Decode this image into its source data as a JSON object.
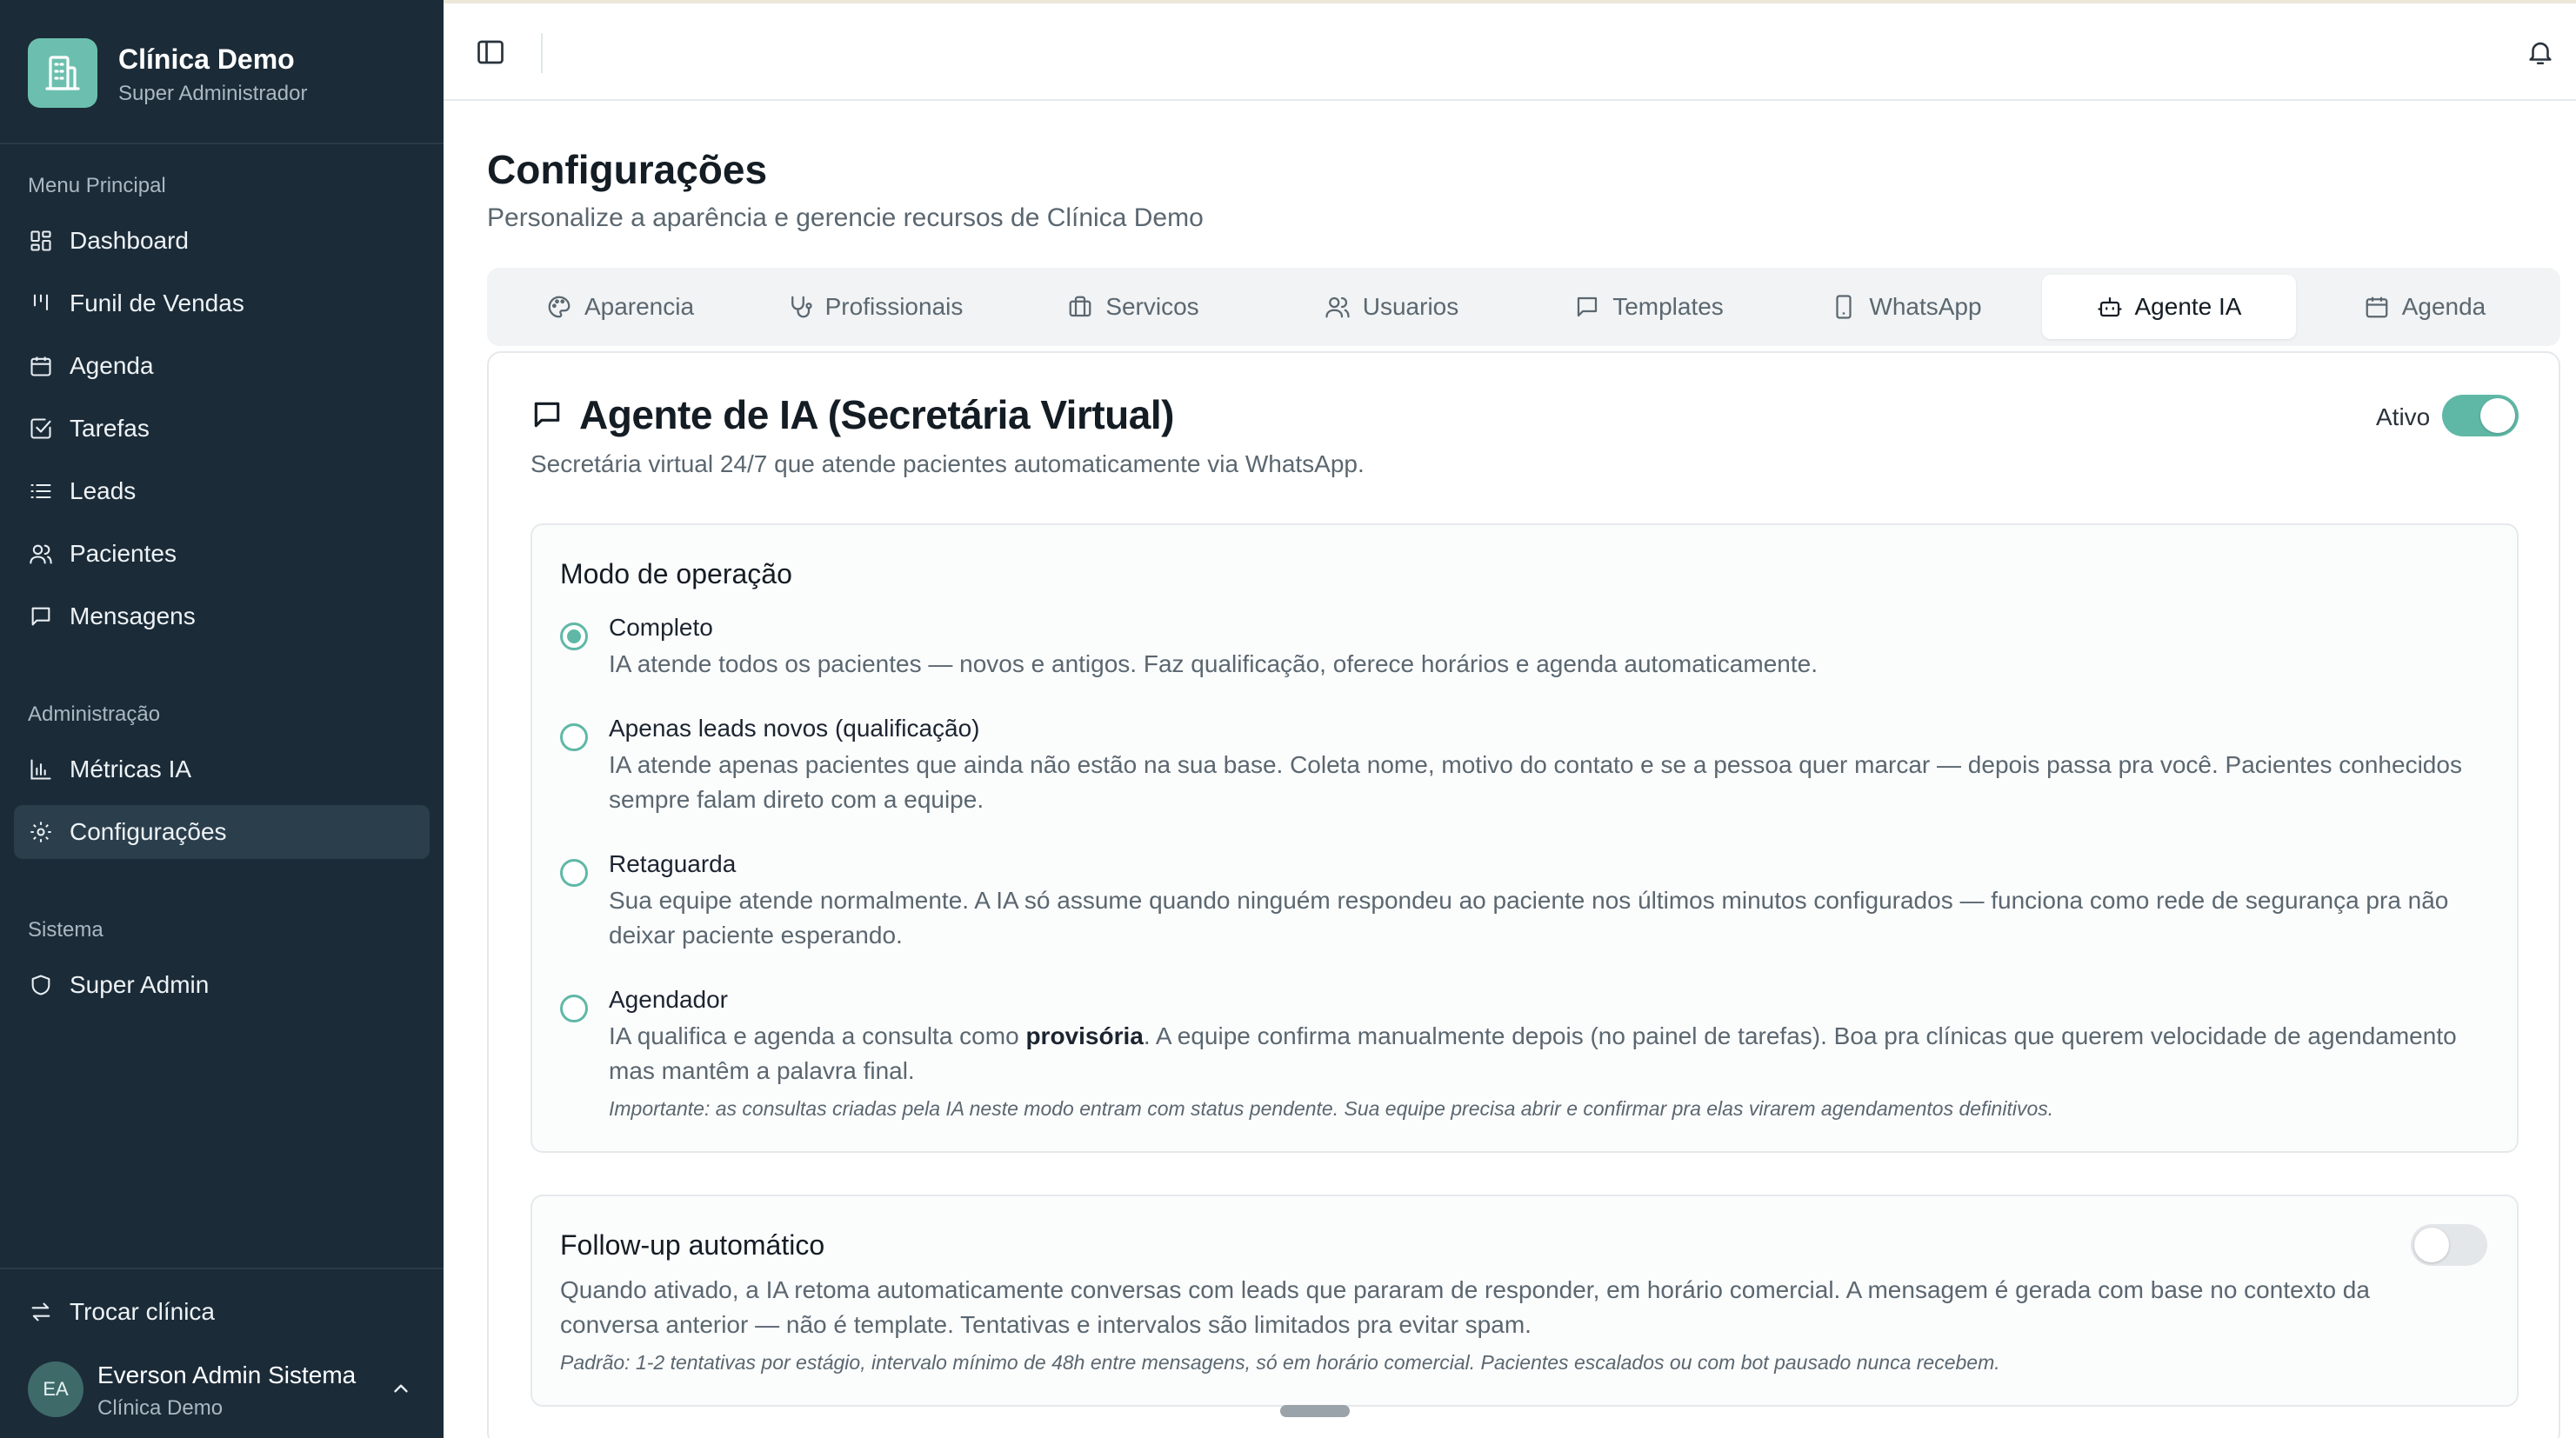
{
  "brand": {
    "title": "Clínica Demo",
    "subtitle": "Super Administrador"
  },
  "sidebar": {
    "sections": [
      {
        "label": "Menu Principal",
        "items": [
          {
            "label": "Dashboard",
            "icon": "dashboard-icon"
          },
          {
            "label": "Funil de Vendas",
            "icon": "funnel-icon"
          },
          {
            "label": "Agenda",
            "icon": "calendar-icon"
          },
          {
            "label": "Tarefas",
            "icon": "checkbox-icon"
          },
          {
            "label": "Leads",
            "icon": "list-icon"
          },
          {
            "label": "Pacientes",
            "icon": "users-icon"
          },
          {
            "label": "Mensagens",
            "icon": "message-icon"
          }
        ]
      },
      {
        "label": "Administração",
        "items": [
          {
            "label": "Métricas IA",
            "icon": "bar-chart-icon"
          },
          {
            "label": "Configurações",
            "icon": "gear-icon",
            "active": true
          }
        ]
      },
      {
        "label": "Sistema",
        "items": [
          {
            "label": "Super Admin",
            "icon": "shield-icon"
          }
        ]
      }
    ],
    "footer": {
      "switch_label": "Trocar clínica",
      "user_initials": "EA",
      "user_name": "Everson Admin Sistema",
      "user_clinic": "Clínica Demo"
    }
  },
  "page": {
    "title": "Configurações",
    "subtitle": "Personalize a aparência e gerencie recursos de Clínica Demo"
  },
  "tabs": [
    {
      "label": "Aparencia",
      "icon": "palette-icon"
    },
    {
      "label": "Profissionais",
      "icon": "stethoscope-icon"
    },
    {
      "label": "Servicos",
      "icon": "briefcase-icon"
    },
    {
      "label": "Usuarios",
      "icon": "users-icon"
    },
    {
      "label": "Templates",
      "icon": "message-icon"
    },
    {
      "label": "WhatsApp",
      "icon": "phone-icon"
    },
    {
      "label": "Agente IA",
      "icon": "bot-icon",
      "active": true
    },
    {
      "label": "Agenda",
      "icon": "calendar-icon"
    }
  ],
  "agent": {
    "title": "Agente de IA (Secretária Virtual)",
    "description": "Secretária virtual 24/7 que atende pacientes automaticamente via WhatsApp.",
    "active_label": "Ativo",
    "active": true
  },
  "mode": {
    "heading": "Modo de operação",
    "options": [
      {
        "title": "Completo",
        "description": "IA atende todos os pacientes — novos e antigos. Faz qualificação, oferece horários e agenda automaticamente.",
        "checked": true
      },
      {
        "title": "Apenas leads novos (qualificação)",
        "description": "IA atende apenas pacientes que ainda não estão na sua base. Coleta nome, motivo do contato e se a pessoa quer marcar — depois passa pra você. Pacientes conhecidos sempre falam direto com a equipe.",
        "checked": false
      },
      {
        "title": "Retaguarda",
        "description": "Sua equipe atende normalmente. A IA só assume quando ninguém respondeu ao paciente nos últimos minutos configurados — funciona como rede de segurança pra não deixar paciente esperando.",
        "checked": false
      },
      {
        "title": "Agendador",
        "description_before": "IA qualifica e agenda a consulta como ",
        "description_bold": "provisória",
        "description_after": ". A equipe confirma manualmente depois (no painel de tarefas). Boa pra clínicas que querem velocidade de agendamento mas mantêm a palavra final.",
        "note": "Importante: as consultas criadas pela IA neste modo entram com status pendente. Sua equipe precisa abrir e confirmar pra elas virarem agendamentos definitivos.",
        "checked": false
      }
    ]
  },
  "followup": {
    "heading": "Follow-up automático",
    "description": "Quando ativado, a IA retoma automaticamente conversas com leads que pararam de responder, em horário comercial. A mensagem é gerada com base no contexto da conversa anterior — não é template. Tentativas e intervalos são limitados pra evitar spam.",
    "note": "Padrão: 1-2 tentativas por estágio, intervalo mínimo de 48h entre mensagens, só em horário comercial. Pacientes escalados ou com bot pausado nunca recebem.",
    "enabled": false
  },
  "colors": {
    "sidebar_bg": "#1b2b38",
    "accent": "#5fb8a6",
    "brand_logo": "#6cbfae"
  }
}
